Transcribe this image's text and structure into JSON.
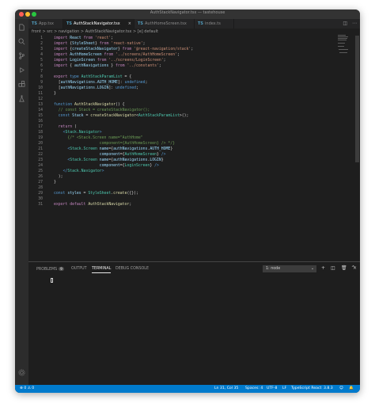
{
  "window": {
    "title": "AuthStackNavigator.tsx — tastehouse"
  },
  "tabs": [
    {
      "label": "App.tsx",
      "active": false
    },
    {
      "label": "AuthStackNavigator.tsx",
      "active": true
    },
    {
      "label": "AuthHomeScreen.tsx",
      "active": false
    },
    {
      "label": "index.ts",
      "active": false
    }
  ],
  "tab_badge": "TS",
  "breadcrumb": "front > src > navigation > AuthStackNavigator.tsx > [e] default",
  "code_lines": [
    {
      "num": "1",
      "text": "import React from 'react';"
    },
    {
      "num": "2",
      "text": "import {StyleSheet} from 'react-native';"
    },
    {
      "num": "3",
      "text": "import {createStackNavigator} from '@react-navigation/stack';"
    },
    {
      "num": "4",
      "text": "import AuthHomeScreen from '../screens/AuthHomeScreen';"
    },
    {
      "num": "5",
      "text": "import LoginScreen from '../screens/LoginScreen';"
    },
    {
      "num": "6",
      "text": "import { authNavigations } from '../constants';"
    },
    {
      "num": "7",
      "text": ""
    },
    {
      "num": "8",
      "text": "export type AuthStackParamList = {"
    },
    {
      "num": "9",
      "text": "  [authNavigations.AUTH_HOME]: undefined;"
    },
    {
      "num": "10",
      "text": "  [authNavigations.LOGIN]: undefined;"
    },
    {
      "num": "11",
      "text": "}"
    },
    {
      "num": "12",
      "text": ""
    },
    {
      "num": "13",
      "text": "function AuthStackNavigator() {"
    },
    {
      "num": "14",
      "text": "  // const Stack = createStackNavigator();"
    },
    {
      "num": "15",
      "text": "  const Stack = createStackNavigator<AuthStackParamList>();"
    },
    {
      "num": "16",
      "text": ""
    },
    {
      "num": "17",
      "text": "  return ("
    },
    {
      "num": "18",
      "text": "    <Stack.Navigator>"
    },
    {
      "num": "19",
      "text": "      {/* <Stack.Screen name=\"AuthHome\""
    },
    {
      "num": "20",
      "text": "                    component={AuthHomeScreen} /> */}"
    },
    {
      "num": "21",
      "text": "      <Stack.Screen name={authNavigations.AUTH_HOME}"
    },
    {
      "num": "22",
      "text": "                    component={AuthHomeScreen} />"
    },
    {
      "num": "23",
      "text": "      <Stack.Screen name={authNavigations.LOGIN}"
    },
    {
      "num": "24",
      "text": "                    component={LoginScreen} />"
    },
    {
      "num": "25",
      "text": "    </Stack.Navigator>"
    },
    {
      "num": "26",
      "text": "  );"
    },
    {
      "num": "27",
      "text": "}"
    },
    {
      "num": "28",
      "text": ""
    },
    {
      "num": "29",
      "text": "const styles = StyleSheet.create({});"
    },
    {
      "num": "30",
      "text": ""
    },
    {
      "num": "31",
      "text": "export default AuthStackNavigator;"
    }
  ],
  "panel": {
    "tabs": [
      "PROBLEMS",
      "OUTPUT",
      "TERMINAL",
      "DEBUG CONSOLE"
    ],
    "problems_count": "9",
    "active_tab": "TERMINAL",
    "terminal_select": "1: node"
  },
  "status": {
    "errors": "0",
    "warnings": "0",
    "position": "Ln 31, Col 35",
    "spaces": "Spaces: 4",
    "encoding": "UTF-8",
    "eol": "LF",
    "language": "TypeScript React",
    "version": "3.8.3"
  },
  "colors": {
    "statusbar": "#007acc",
    "background": "#1e1e1e"
  }
}
